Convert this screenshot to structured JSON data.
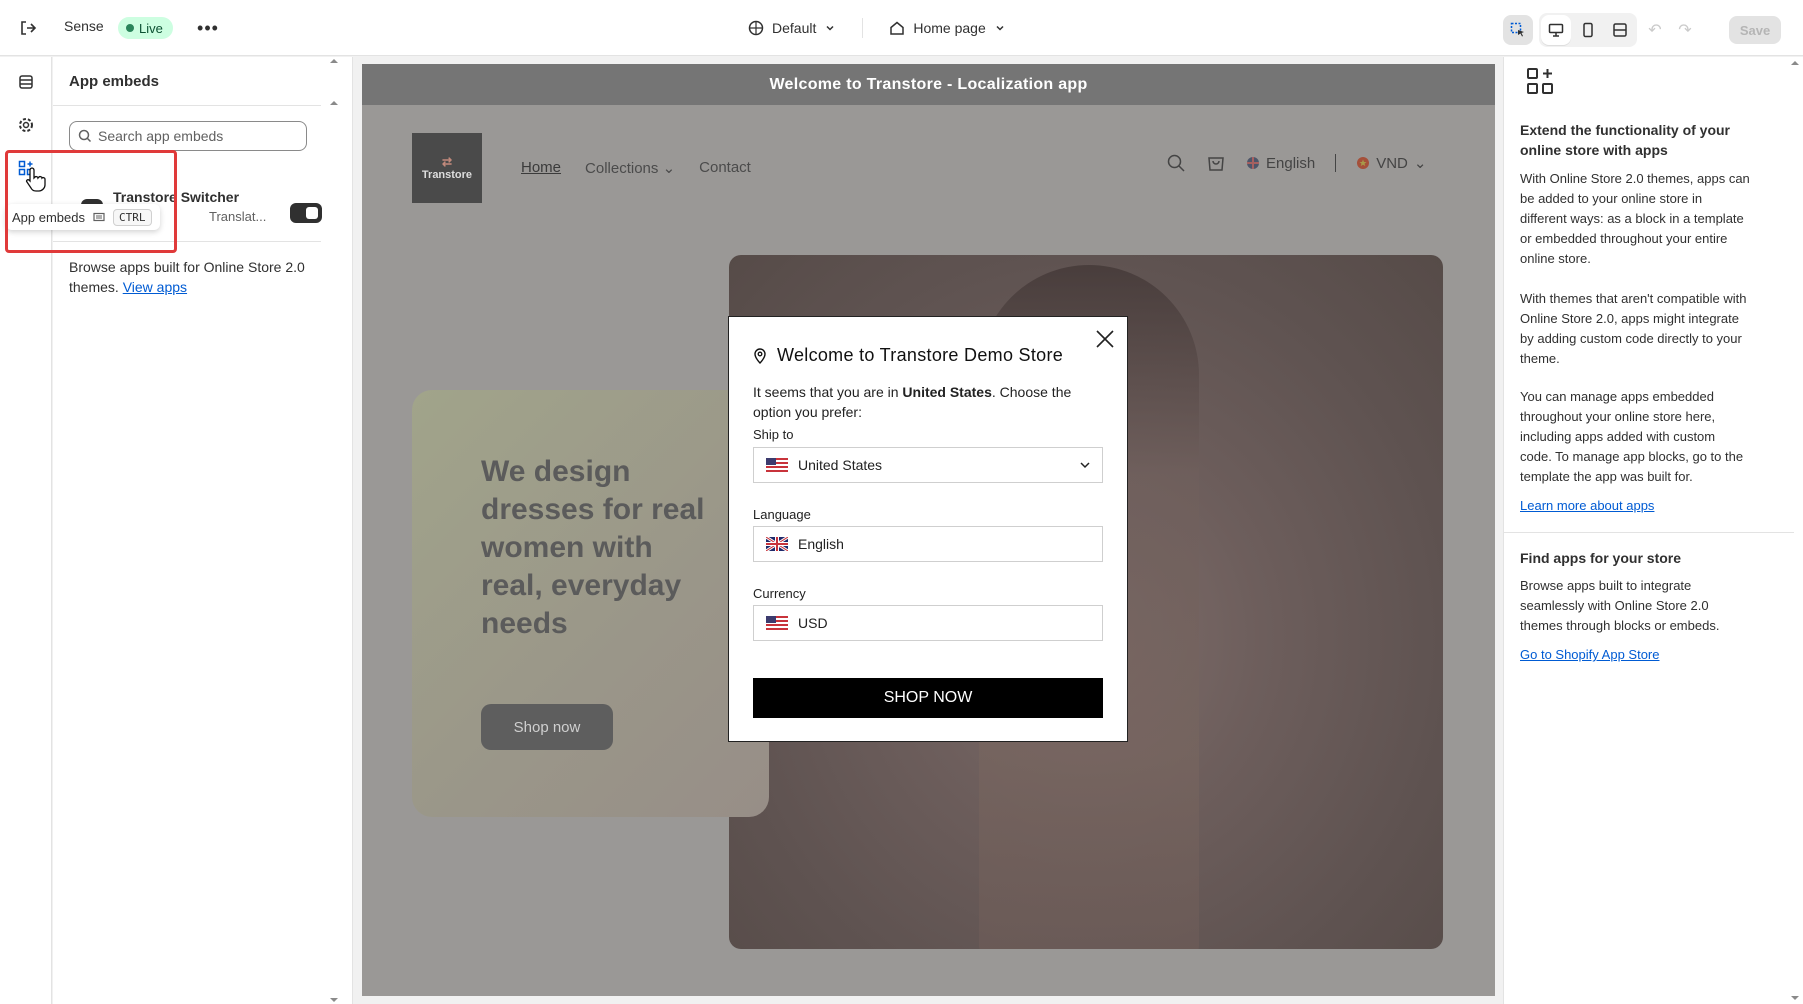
{
  "topbar": {
    "theme_name": "Sense",
    "status_badge": "Live",
    "template_selector": "Default",
    "page_selector": "Home page",
    "save_label": "Save"
  },
  "tooltip": {
    "label": "App embeds",
    "shortcut_key": "CTRL"
  },
  "panel": {
    "title": "App embeds",
    "search_placeholder": "Search app embeds",
    "app_name": "Transtore Switcher",
    "app_subtitle": "Translat...",
    "app_enabled": true,
    "browse_text": "Browse apps built for Online Store 2.0 themes.",
    "browse_link": "View apps"
  },
  "preview": {
    "announcement": "Welcome to Transtore - Localization app",
    "logo_text": "Transtore",
    "nav": [
      "Home",
      "Collections",
      "Contact"
    ],
    "language": "English",
    "currency": "VND",
    "hero_heading": "We design dresses for real women with real, everyday needs",
    "hero_button": "Shop now"
  },
  "modal": {
    "title": "Welcome to Transtore Demo Store",
    "message_prefix": "It seems that you are in ",
    "message_country": "United States",
    "message_suffix": ". Choose the option you prefer:",
    "ship_label": "Ship to",
    "ship_value": "United States",
    "language_label": "Language",
    "language_value": "English",
    "currency_label": "Currency",
    "currency_value": "USD",
    "cta": "SHOP NOW"
  },
  "right_panel": {
    "heading1": "Extend the functionality of your online store with apps",
    "para1": "With Online Store 2.0 themes, apps can be added to your online store in different ways: as a block in a template or embedded throughout your entire online store.",
    "para2": "With themes that aren't compatible with Online Store 2.0, apps might integrate by adding custom code directly to your theme.",
    "para3": "You can manage apps embedded throughout your online store here, including apps added with custom code. To manage app blocks, go to the template the app was built for.",
    "link1": "Learn more about apps",
    "heading2": "Find apps for your store",
    "para4": "Browse apps built to integrate seamlessly with Online Store 2.0 themes through blocks or embeds.",
    "link2": "Go to Shopify App Store"
  },
  "colors": {
    "live_badge_bg": "#cdfee1",
    "link": "#005bd3",
    "highlight": "#e03a3a"
  }
}
